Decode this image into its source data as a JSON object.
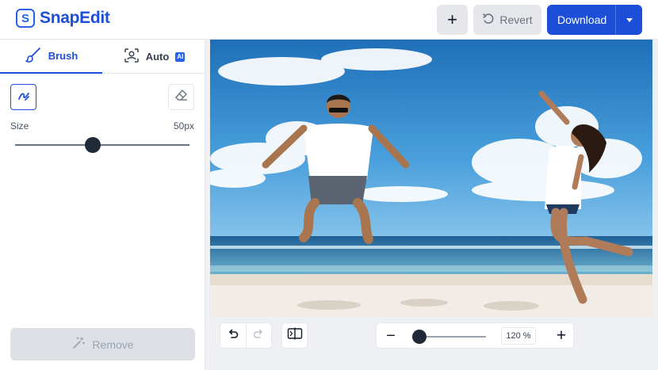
{
  "app": {
    "logo_glyph": "S",
    "name": "SnapEdit"
  },
  "header": {
    "add_label": "+",
    "revert_label": "Revert",
    "download_label": "Download"
  },
  "panel": {
    "tabs": [
      {
        "label": "Brush",
        "icon": "brush-icon",
        "active": true
      },
      {
        "label": "Auto",
        "icon": "face-scan-icon",
        "badge": "AI",
        "active": false
      }
    ],
    "size_label": "Size",
    "size_value": "50px",
    "size_level_percent": 45,
    "remove_label": "Remove"
  },
  "toolbar": {
    "zoom_minus": "−",
    "zoom_value": "120 %",
    "zoom_plus": "+",
    "zoom_level_percent": 10
  },
  "colors": {
    "accent": "#1d4ed8",
    "sky": "#3b8fd1",
    "sand": "#f1ede6"
  }
}
